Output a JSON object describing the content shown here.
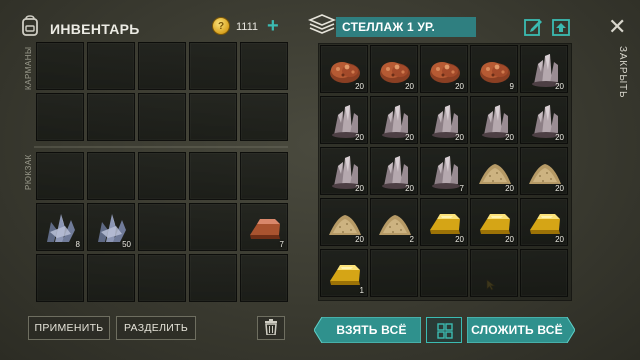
{
  "header": {
    "title": "ИНВЕНТАРЬ",
    "coins": "1111",
    "coin_symbol": "?",
    "plus": "+",
    "crate_title": "СТЕЛЛАЖ 1 УР."
  },
  "inventory": {
    "pockets_label": "КАРМАНЫ",
    "backpack_label": "РЮКЗАК",
    "backpack_items": [
      {
        "slot": 15,
        "icon": "iron-ore-icon",
        "count": "8"
      },
      {
        "slot": 16,
        "icon": "iron-ore-icon",
        "count": "50"
      },
      {
        "slot": 19,
        "icon": "copper-ingot-icon",
        "count": "7"
      }
    ],
    "apply_label": "ПРИМЕНИТЬ",
    "split_label": "РАЗДЕЛИТЬ"
  },
  "crate": {
    "items": [
      {
        "icon": "copper-ore-icon",
        "count": "20"
      },
      {
        "icon": "copper-ore-icon",
        "count": "20"
      },
      {
        "icon": "copper-ore-icon",
        "count": "20"
      },
      {
        "icon": "copper-ore-icon",
        "count": "9"
      },
      {
        "icon": "quartz-icon",
        "count": "20"
      },
      {
        "icon": "quartz-icon",
        "count": "20"
      },
      {
        "icon": "quartz-icon",
        "count": "20"
      },
      {
        "icon": "quartz-icon",
        "count": "20"
      },
      {
        "icon": "quartz-icon",
        "count": "20"
      },
      {
        "icon": "quartz-icon",
        "count": "20"
      },
      {
        "icon": "quartz-icon",
        "count": "20"
      },
      {
        "icon": "quartz-icon",
        "count": "20"
      },
      {
        "icon": "quartz-icon",
        "count": "7"
      },
      {
        "icon": "sand-icon",
        "count": "20"
      },
      {
        "icon": "sand-icon",
        "count": "20"
      },
      {
        "icon": "sand-icon",
        "count": "20"
      },
      {
        "icon": "sand-icon",
        "count": "2"
      },
      {
        "icon": "gold-ingot-icon",
        "count": "20"
      },
      {
        "icon": "gold-ingot-icon",
        "count": "20"
      },
      {
        "icon": "gold-ingot-icon",
        "count": "20"
      },
      {
        "icon": "gold-ingot-icon",
        "count": "1"
      }
    ],
    "take_all_label": "ВЗЯТЬ ВСЁ",
    "stack_all_label": "СЛОЖИТЬ ВСЁ"
  },
  "close_label": "ЗАКРЫТЬ",
  "colors": {
    "accent": "#2f7f80",
    "button_teal": "#3aa7a3",
    "coin": "#d9a321"
  }
}
